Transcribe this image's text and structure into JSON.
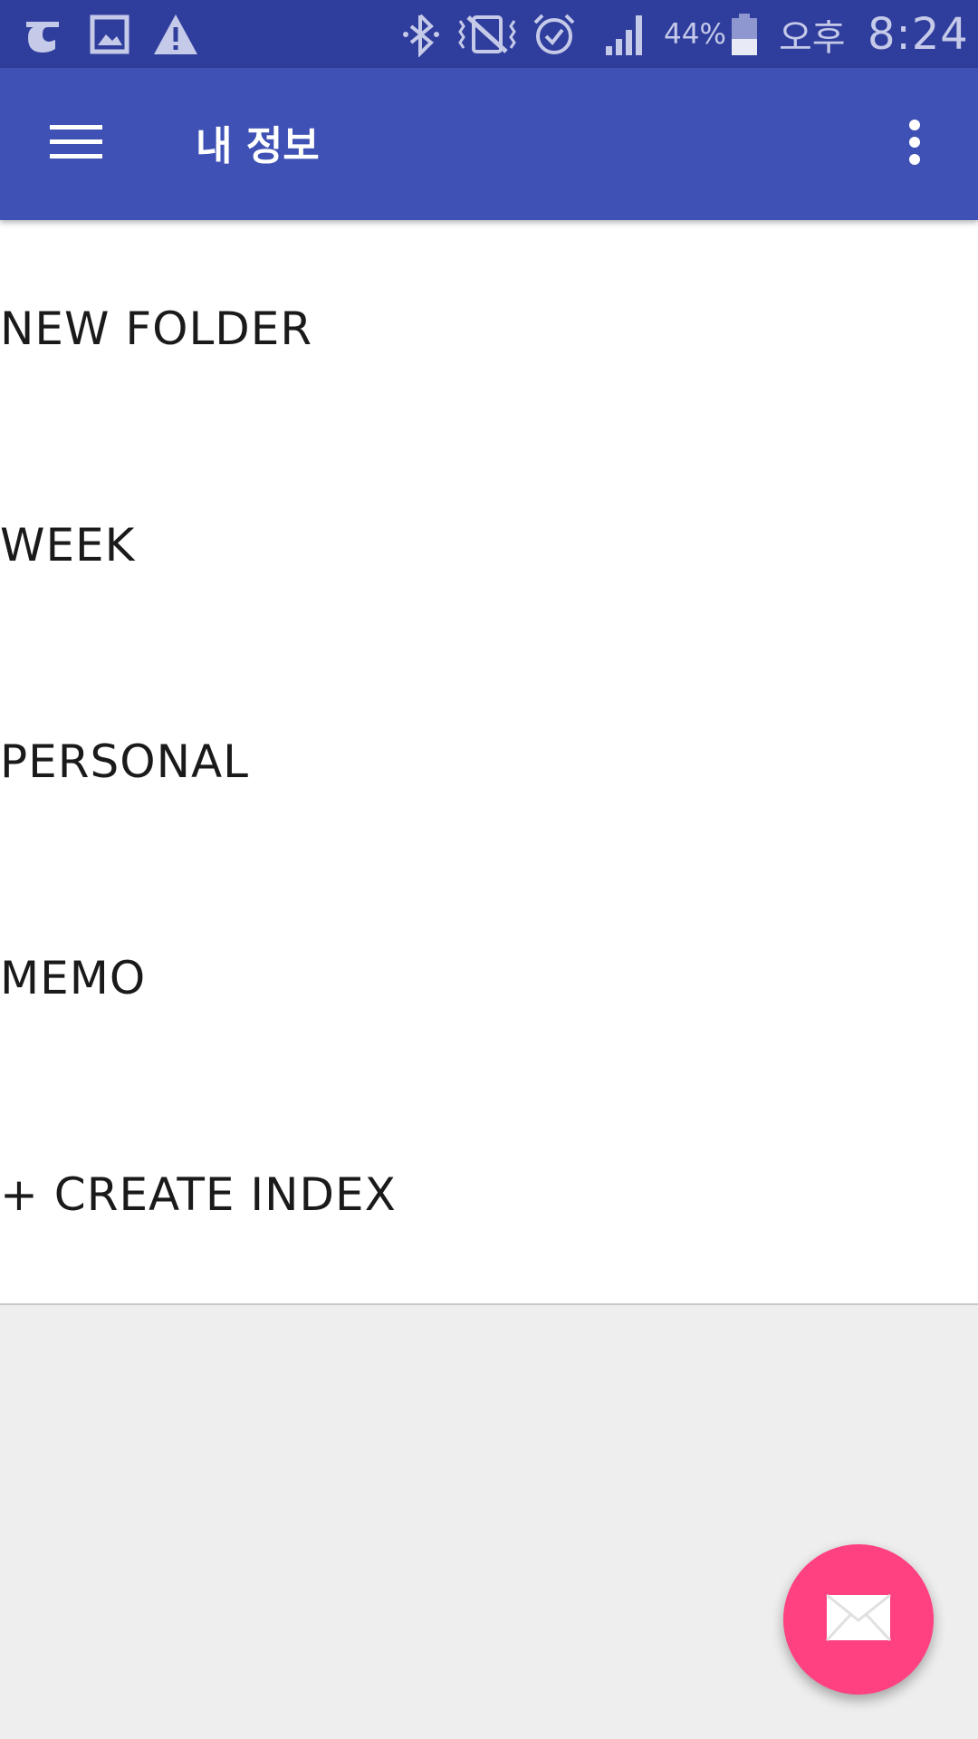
{
  "status_bar": {
    "icons": [
      "g-icon",
      "image-icon",
      "warning-icon",
      "bluetooth-icon",
      "vibrate-icon",
      "alarm-icon",
      "signal-icon",
      "battery-icon"
    ],
    "battery_percent": "44%",
    "ampm": "오후",
    "time": "8:24",
    "battery_level": 0.44
  },
  "app_bar": {
    "title": "내 정보",
    "menu_icon": "hamburger-menu-icon",
    "overflow_icon": "more-vert-icon",
    "color": "#3f51b5"
  },
  "list": {
    "items": [
      {
        "label": "NEW FOLDER"
      },
      {
        "label": "WEEK"
      },
      {
        "label": "PERSONAL"
      },
      {
        "label": "MEMO"
      },
      {
        "label": "+ CREATE INDEX"
      }
    ]
  },
  "fab": {
    "icon": "mail-icon",
    "color": "#ff4081"
  },
  "colors": {
    "status_bar": "#2f3d9c",
    "background": "#eeeeee",
    "content": "#ffffff"
  }
}
